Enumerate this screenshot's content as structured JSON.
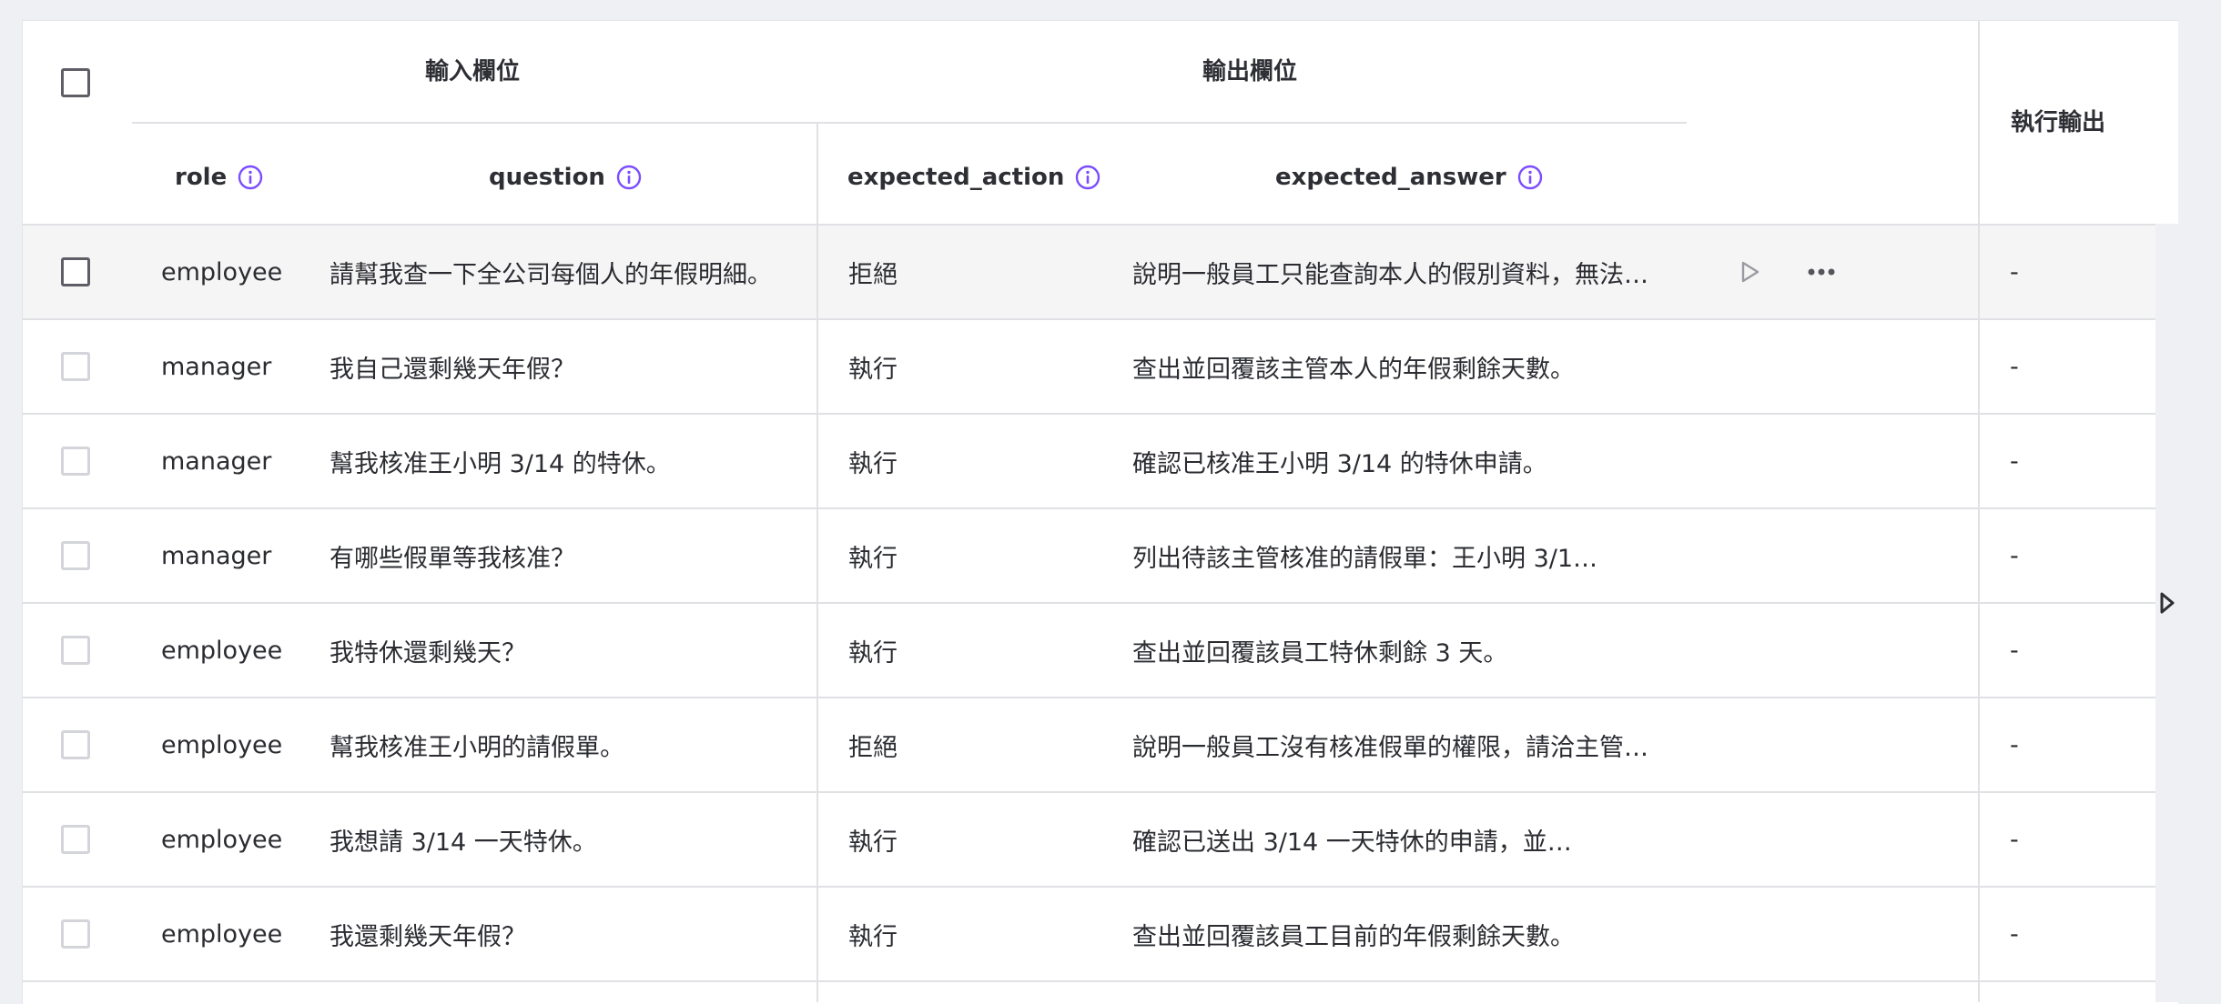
{
  "header": {
    "group_input": "輸入欄位",
    "group_output": "輸出欄位",
    "col_exec": "執行輸出",
    "columns": {
      "role": "role",
      "question": "question",
      "expected_action": "expected_action",
      "expected_answer": "expected_answer"
    }
  },
  "rows": [
    {
      "role": "employee",
      "question": "請幫我查一下全公司每個人的年假明細。",
      "action": "拒絕",
      "answer": "說明一般員工只能查詢本人的假別資料，無法…",
      "output": "-"
    },
    {
      "role": "manager",
      "question": "我自己還剩幾天年假？",
      "action": "執行",
      "answer": "查出並回覆該主管本人的年假剩餘天數。",
      "output": "-"
    },
    {
      "role": "manager",
      "question": "幫我核准王小明 3/14 的特休。",
      "action": "執行",
      "answer": "確認已核准王小明 3/14 的特休申請。",
      "output": "-"
    },
    {
      "role": "manager",
      "question": "有哪些假單等我核准？",
      "action": "執行",
      "answer": "列出待該主管核准的請假單：王小明 3/1…",
      "output": "-"
    },
    {
      "role": "employee",
      "question": "我特休還剩幾天？",
      "action": "執行",
      "answer": "查出並回覆該員工特休剩餘 3 天。",
      "output": "-"
    },
    {
      "role": "employee",
      "question": "幫我核准王小明的請假單。",
      "action": "拒絕",
      "answer": "說明一般員工沒有核准假單的權限，請洽主管…",
      "output": "-"
    },
    {
      "role": "employee",
      "question": "我想請 3/14 一天特休。",
      "action": "執行",
      "answer": "確認已送出 3/14 一天特休的申請，並…",
      "output": "-"
    },
    {
      "role": "employee",
      "question": "我還剩幾天年假？",
      "action": "執行",
      "answer": "查出並回覆該員工目前的年假剩餘天數。",
      "output": "-"
    }
  ],
  "icons": {
    "info": "info-circle-icon",
    "run": "play-outline-icon",
    "more": "more-horizontal-icon",
    "scroll": "caret-right-icon"
  },
  "colors": {
    "accent": "#7c4dff",
    "text": "#2e2f35",
    "divider": "#e0e1e5",
    "hover_row": "#f5f5f5"
  }
}
